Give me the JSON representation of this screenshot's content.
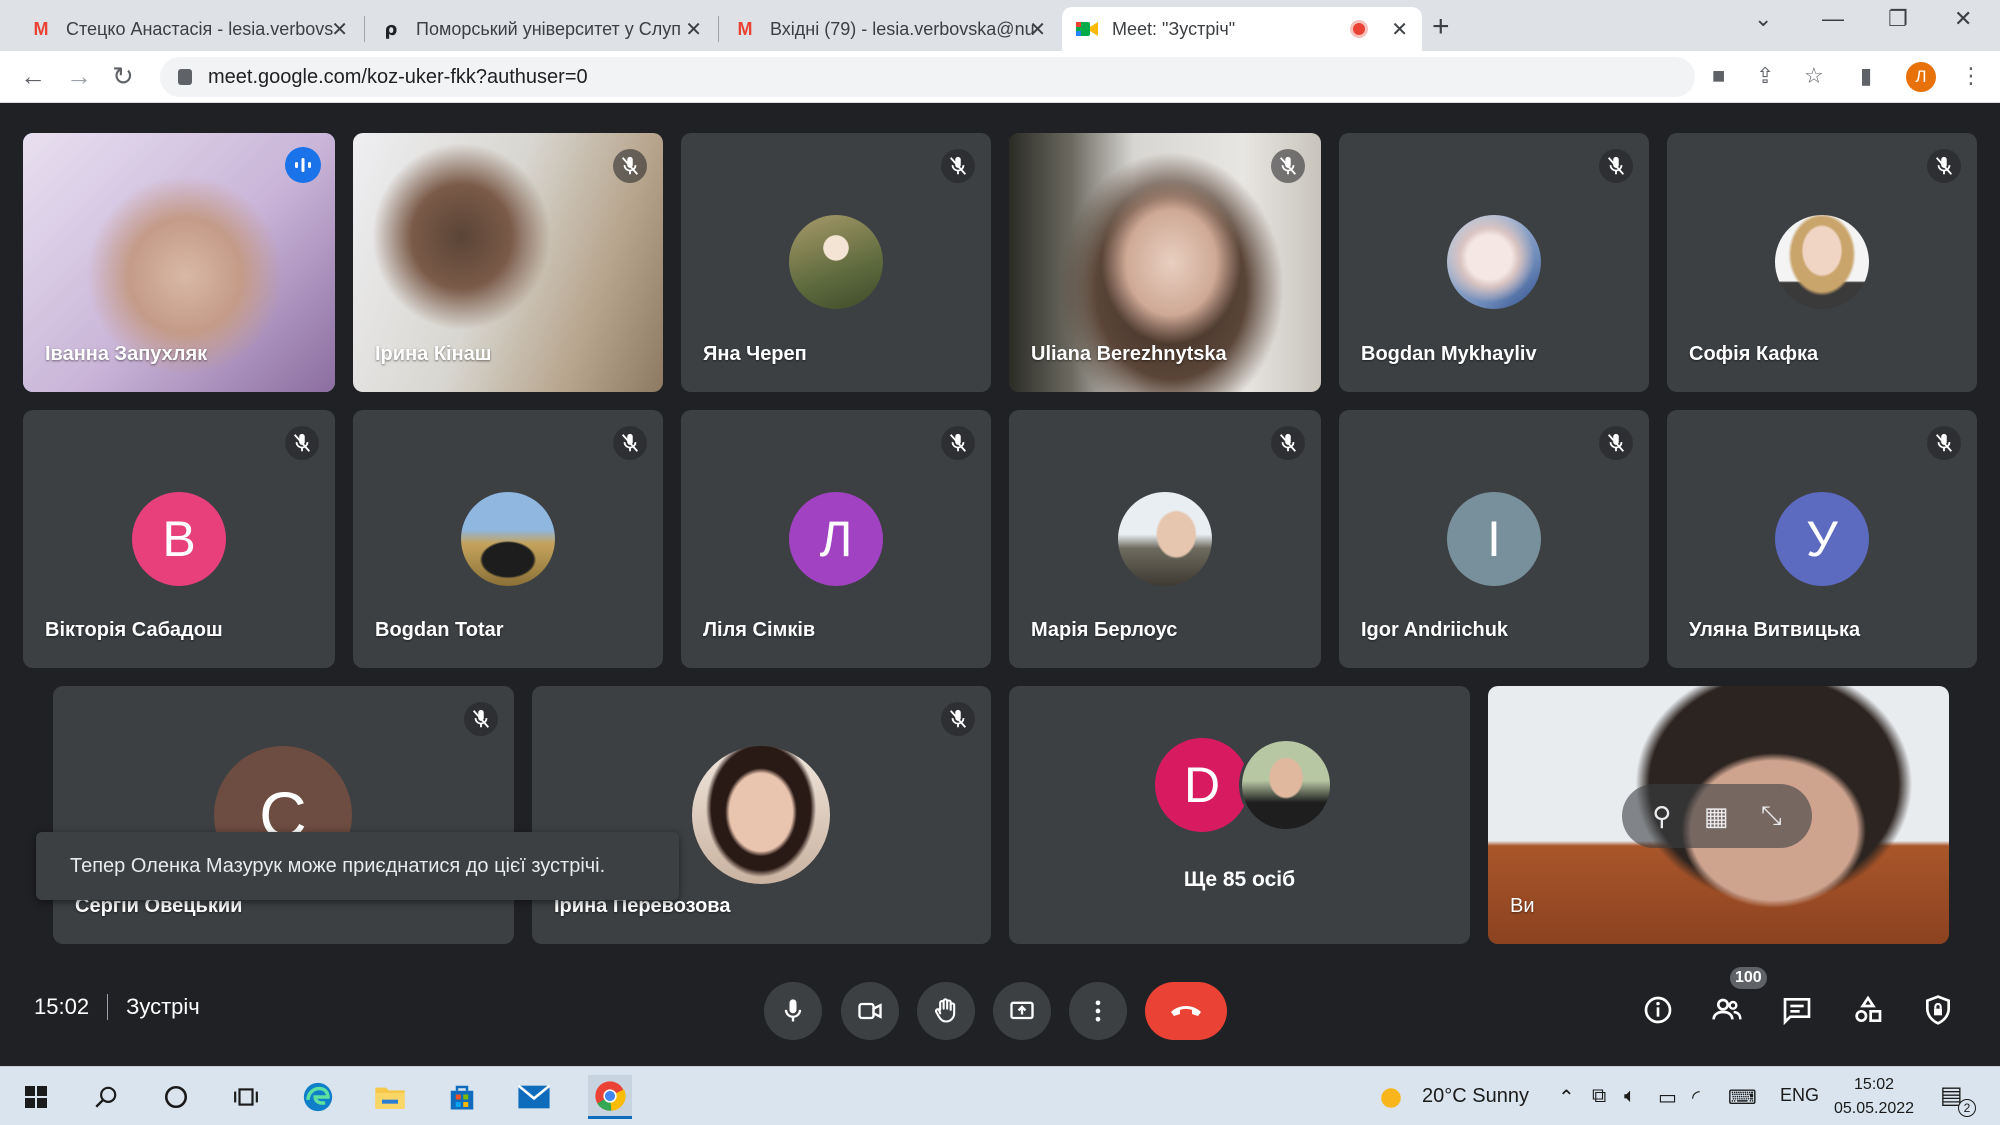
{
  "browser": {
    "tabs": [
      {
        "title": "Стецко Анастасія - lesia.verbovs",
        "favicon": "gmail-icon"
      },
      {
        "title": "Поморський університет у Слуп",
        "favicon": "university-icon"
      },
      {
        "title": "Вхідні (79) - lesia.verbovska@nu",
        "favicon": "gmail-icon"
      },
      {
        "title": "Meet: \"Зустріч\"",
        "favicon": "meet-icon"
      }
    ],
    "url": "meet.google.com/koz-uker-fkk?authuser=0",
    "profile_initial": "Л"
  },
  "tiles": [
    {
      "name": "Іванна Запухляк",
      "kind": "video",
      "speaking": true
    },
    {
      "name": "Ірина Кінаш",
      "kind": "video",
      "muted": true
    },
    {
      "name": "Яна Череп",
      "kind": "photo",
      "muted": true
    },
    {
      "name": "Uliana Berezhnytska",
      "kind": "video",
      "muted": true
    },
    {
      "name": "Bogdan Mykhayliv",
      "kind": "photo",
      "muted": true
    },
    {
      "name": "Софія Кафка",
      "kind": "photo",
      "muted": true
    },
    {
      "name": "Вікторія Сабадош",
      "kind": "letter",
      "letter": "В",
      "color": "#e8407a",
      "muted": true
    },
    {
      "name": "Bogdan Totar",
      "kind": "photo",
      "muted": true
    },
    {
      "name": "Ліля Сімків",
      "kind": "letter",
      "letter": "Л",
      "color": "#a142c2",
      "muted": true
    },
    {
      "name": "Марія Берлоус",
      "kind": "photo",
      "muted": true
    },
    {
      "name": "Igor Andriichuk",
      "kind": "letter",
      "letter": "I",
      "color": "#78909c",
      "muted": true
    },
    {
      "name": "Уляна Витвицька",
      "kind": "letter",
      "letter": "У",
      "color": "#5c6bc0",
      "muted": true
    },
    {
      "name": "Сергій Овецький",
      "kind": "letter",
      "letter": "С",
      "color": "#6d4c41",
      "muted": true
    },
    {
      "name": "Ірина Перевозова",
      "kind": "photo",
      "muted": true
    }
  ],
  "more": {
    "letter": "D",
    "label": "Ще 85 осіб",
    "color": "#d81b60"
  },
  "self": {
    "label": "Ви"
  },
  "toast": "Тепер Оленка Мазурук може приєднатися до цієї зустрічі.",
  "meeting": {
    "time": "15:02",
    "title": "Зустріч",
    "participants_badge": "100"
  },
  "taskbar": {
    "weather": "20°C  Sunny",
    "language": "ENG",
    "time": "15:02",
    "date": "05.05.2022",
    "notifications": "2"
  },
  "colors": {
    "speaking_outline": "#8ab4f8",
    "hangup": "#ea4335",
    "tile_bg": "#3c4043"
  }
}
